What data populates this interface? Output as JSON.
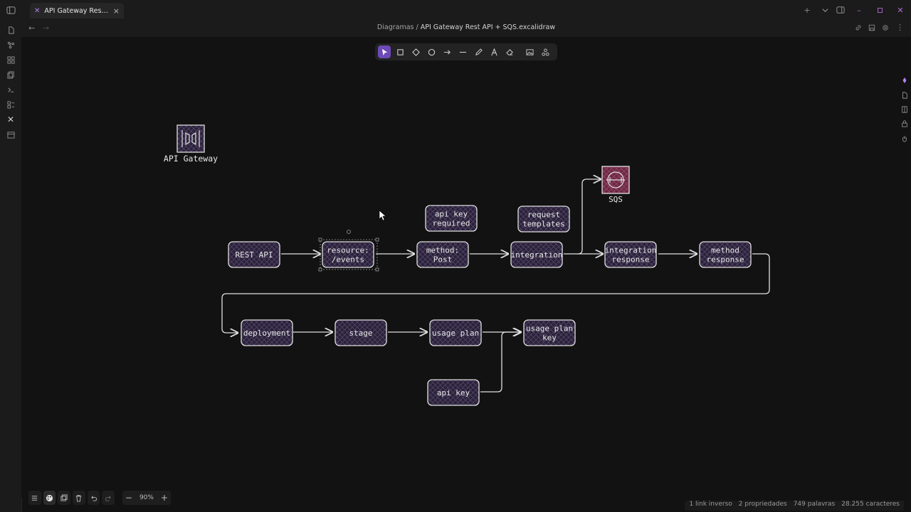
{
  "app": {
    "tab_title": "API Gateway Rest AP...",
    "breadcrumb_folder": "Diagramas",
    "breadcrumb_sep": "/",
    "breadcrumb_file": "API Gateway Rest API + SQS.excalidraw"
  },
  "diagram": {
    "gateway_label": "API Gateway",
    "sqs_label": "SQS",
    "nodes": {
      "rest_api": [
        "REST API"
      ],
      "resource": [
        "resource:",
        "/events"
      ],
      "method": [
        "method:",
        "Post"
      ],
      "integration": [
        "integration"
      ],
      "integration_response": [
        "integration",
        "response"
      ],
      "method_response": [
        "method",
        "response"
      ],
      "api_key_required": [
        "api key",
        "required"
      ],
      "request_templates": [
        "request",
        "templates"
      ],
      "deployment": [
        "deployment"
      ],
      "stage": [
        "stage"
      ],
      "usage_plan": [
        "usage plan"
      ],
      "usage_plan_key": [
        "usage plan",
        "key"
      ],
      "api_key": [
        "api key"
      ]
    }
  },
  "zoom": {
    "level": "90%"
  },
  "status": {
    "backlinks": "1 link inverso",
    "properties": "2 propriedades",
    "words": "749 palavras",
    "characters": "28.255 caracteres"
  },
  "colors": {
    "accent": "#6e4ab8",
    "node_fill": "#3b2d50",
    "sqs_fill": "#7a2e4a",
    "stroke": "#e0e0e0"
  }
}
